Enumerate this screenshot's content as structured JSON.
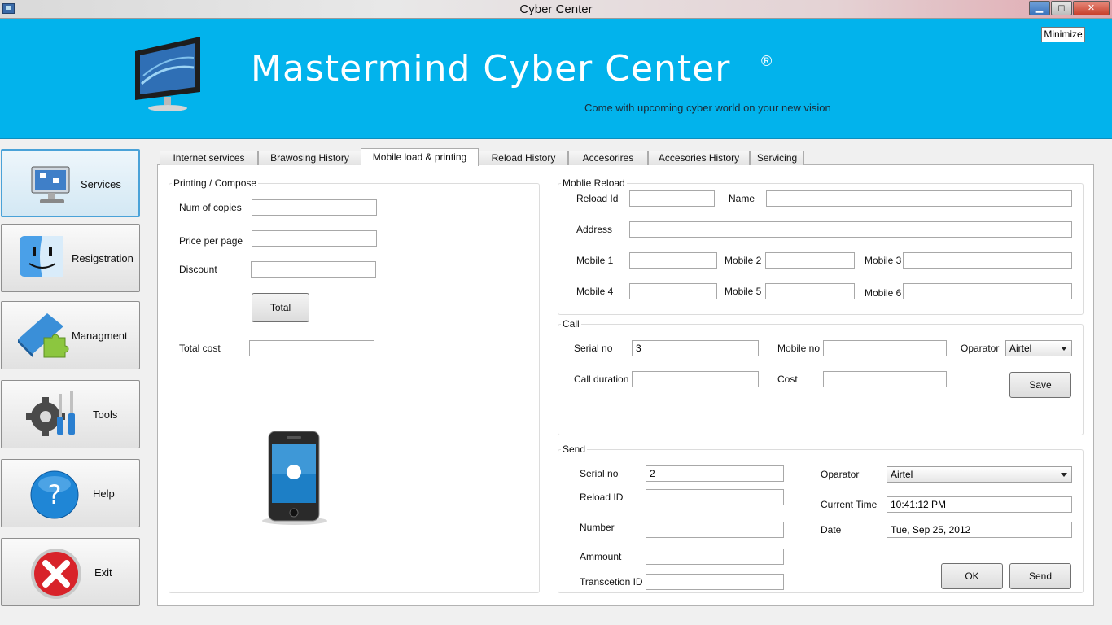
{
  "window": {
    "title": "Cyber Center",
    "controls": {
      "minimize": "▁",
      "maximize": "◻",
      "close": "✕"
    }
  },
  "header": {
    "brand": "Mastermind  Cyber Center",
    "registered_mark": "®",
    "tagline": "Come with upcoming cyber world on your new vision",
    "minimize_tooltip": "Minimize",
    "background_color": "#02b3ec"
  },
  "nav": {
    "items": [
      {
        "label": "Services",
        "icon": "computer-icon",
        "active": true
      },
      {
        "label": "Resigstration",
        "icon": "finder-face-icon",
        "active": false
      },
      {
        "label": "Managment",
        "icon": "book-puzzle-icon",
        "active": false
      },
      {
        "label": "Tools",
        "icon": "gear-screwdriver-icon",
        "active": false
      },
      {
        "label": "Help",
        "icon": "help-icon",
        "active": false
      },
      {
        "label": "Exit",
        "icon": "exit-icon",
        "active": false
      }
    ]
  },
  "tabs": [
    {
      "label": "Internet services"
    },
    {
      "label": "Brawosing History"
    },
    {
      "label": "Mobile load & printing",
      "active": true
    },
    {
      "label": "Reload History"
    },
    {
      "label": "Accesorires"
    },
    {
      "label": "Accesories History"
    },
    {
      "label": "Servicing"
    }
  ],
  "printing": {
    "title": "Printing / Compose",
    "num_copies_label": "Num of copies",
    "num_copies_value": "",
    "price_per_page_label": "Price per page",
    "price_per_page_value": "",
    "discount_label": "Discount",
    "discount_value": "",
    "total_button": "Total",
    "total_cost_label": "Total cost",
    "total_cost_value": ""
  },
  "mobile_reload": {
    "title": "Moblie Reload",
    "reload_id_label": "Reload Id",
    "name_label": "Name",
    "address_label": "Address",
    "mobile1_label": "Mobile 1",
    "mobile2_label": "Mobile 2",
    "mobile3_label": "Mobile 3",
    "mobile4_label": "Mobile 4",
    "mobile5_label": "Mobile 5",
    "mobile6_label": "Mobile 6"
  },
  "call": {
    "title": "Call",
    "serial_no_label": "Serial no",
    "serial_no_value": "3",
    "mobile_no_label": "Mobile no",
    "operator_label": "Oparator",
    "operator_value": "Airtel",
    "call_duration_label": "Call duration",
    "cost_label": "Cost",
    "save_button": "Save"
  },
  "send": {
    "title": "Send",
    "serial_no_label": "Serial no",
    "serial_no_value": "2",
    "reload_id_label": "Reload ID",
    "number_label": "Number",
    "amount_label": "Ammount",
    "transaction_id_label": "Transcetion ID",
    "operator_label": "Oparator",
    "operator_value": "Airtel",
    "current_time_label": "Current Time",
    "current_time_value": "10:41:12 PM",
    "date_label": "Date",
    "date_value": "Tue, Sep 25, 2012",
    "ok_button": "OK",
    "send_button": "Send"
  }
}
